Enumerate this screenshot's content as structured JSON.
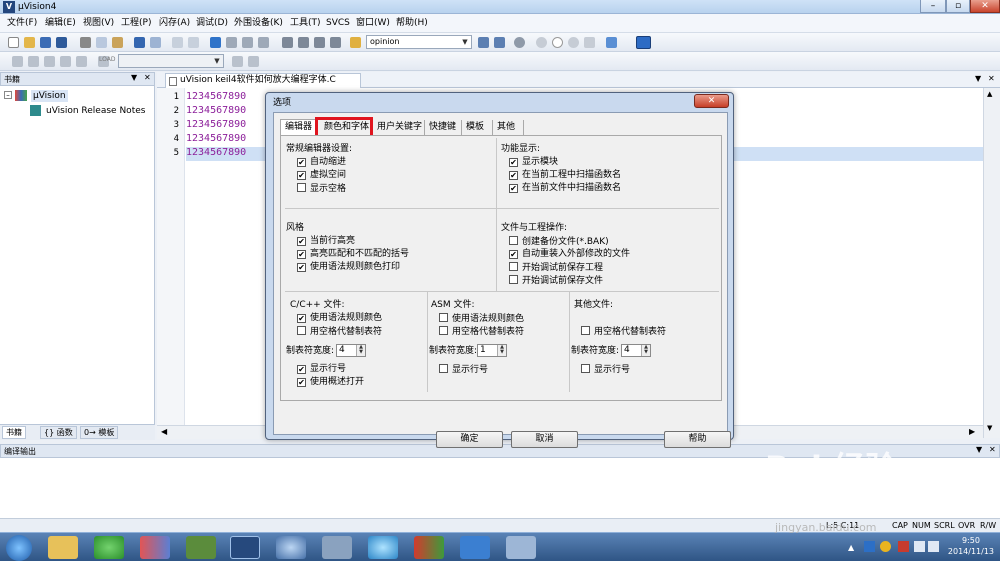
{
  "window": {
    "title": "µVision4",
    "icon_letter": "V",
    "min": "–",
    "max": "▫",
    "close": "✕"
  },
  "menu": [
    "文件(F)",
    "编辑(E)",
    "视图(V)",
    "工程(P)",
    "闪存(A)",
    "调试(D)",
    "外围设备(K)",
    "工具(T)",
    "SVCS",
    "窗口(W)",
    "帮助(H)"
  ],
  "toolbar": {
    "find_combo": "opinion",
    "target_combo": "LOAD"
  },
  "left_panel": {
    "title": "书籍",
    "tree": {
      "root": "µVision",
      "child": "uVision Release Notes"
    },
    "tabs": [
      "书籍",
      "{} 函数",
      "0→ 模板"
    ]
  },
  "editor": {
    "tab_label": "uVision keil4软件如何放大编程字体.C",
    "lines": [
      {
        "num": "1",
        "text": "1234567890"
      },
      {
        "num": "2",
        "text": "1234567890"
      },
      {
        "num": "3",
        "text": "1234567890"
      },
      {
        "num": "4",
        "text": "1234567890"
      },
      {
        "num": "5",
        "text": "1234567890"
      }
    ]
  },
  "build": {
    "title": "编译输出"
  },
  "statusbar": {
    "position": "L:5 C:11",
    "caps": "CAP",
    "num": "NUM",
    "scrl": "SCRL",
    "ovr": "OVR",
    "rw": "R/W"
  },
  "dialog": {
    "title": "选项",
    "close": "✕",
    "tabs": [
      "编辑器",
      "颜色和字体",
      "用户关键字",
      "快捷键",
      "模板",
      "其他"
    ],
    "active_tab": "编辑器",
    "highlighted_tab": "颜色和字体",
    "general": {
      "title": "常规编辑器设置:",
      "options": [
        {
          "label": "自动缩进",
          "checked": true
        },
        {
          "label": "虚拟空间",
          "checked": true
        },
        {
          "label": "显示空格",
          "checked": false
        }
      ]
    },
    "function": {
      "title": "功能显示:",
      "options": [
        {
          "label": "显示模块",
          "checked": true
        },
        {
          "label": "在当前工程中扫描函数名",
          "checked": true
        },
        {
          "label": "在当前文件中扫描函数名",
          "checked": true
        }
      ]
    },
    "style": {
      "title": "风格",
      "options": [
        {
          "label": "当前行高亮",
          "checked": true
        },
        {
          "label": "高亮匹配和不匹配的括号",
          "checked": true
        },
        {
          "label": "使用语法规则颜色打印",
          "checked": true
        }
      ]
    },
    "files": {
      "title": "文件与工程操作:",
      "options": [
        {
          "label": "创建备份文件(*.BAK)",
          "checked": false
        },
        {
          "label": "自动重装入外部修改的文件",
          "checked": true
        },
        {
          "label": "开始调试前保存工程",
          "checked": false
        },
        {
          "label": "开始调试前保存文件",
          "checked": false
        }
      ]
    },
    "c_files": {
      "title": "C/C++ 文件:",
      "opts": [
        {
          "label": "使用语法规则颜色",
          "checked": true
        },
        {
          "label": "用空格代替制表符",
          "checked": false
        }
      ],
      "tab_label": "制表符宽度:",
      "tab_value": "4",
      "opts2": [
        {
          "label": "显示行号",
          "checked": true
        },
        {
          "label": "使用概述打开",
          "checked": true
        }
      ]
    },
    "asm_files": {
      "title": "ASM 文件:",
      "opts": [
        {
          "label": "使用语法规则颜色",
          "checked": false
        },
        {
          "label": "用空格代替制表符",
          "checked": false
        }
      ],
      "tab_label": "制表符宽度:",
      "tab_value": "1",
      "opts2": [
        {
          "label": "显示行号",
          "checked": false
        }
      ]
    },
    "other_files": {
      "title": "其他文件:",
      "opts": [
        {
          "label": "用空格代替制表符",
          "checked": false
        }
      ],
      "tab_label": "制表符宽度:",
      "tab_value": "4",
      "opts2": [
        {
          "label": "显示行号",
          "checked": false
        }
      ]
    },
    "buttons": {
      "ok": "确定",
      "cancel": "取消",
      "help": "帮助"
    }
  },
  "taskbar": {
    "time": "9:50",
    "date": "2014/11/13"
  },
  "watermark": {
    "text": "Bai 经验",
    "sub": "jingyan.baidu.com"
  }
}
